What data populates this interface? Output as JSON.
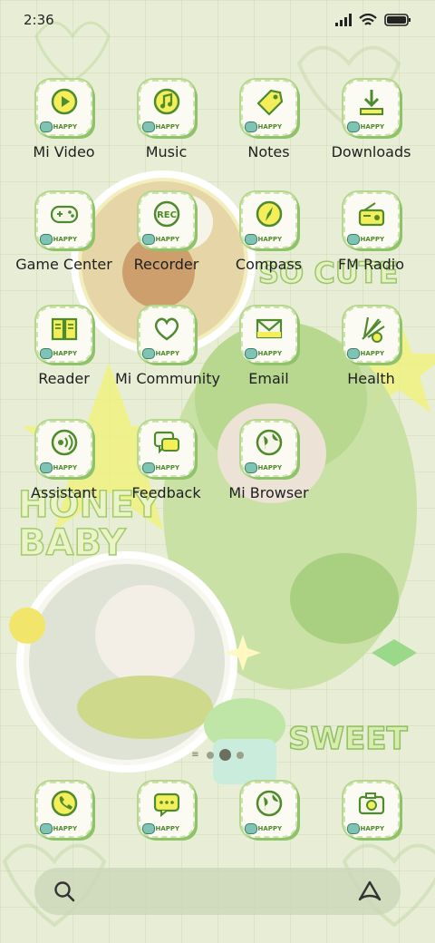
{
  "status_bar": {
    "time": "2:36"
  },
  "wallpaper": {
    "texts": {
      "so_cute": "SO CUTE",
      "honey": "HONEY",
      "baby": "BABY",
      "sweet": "SWEET"
    }
  },
  "apps": [
    {
      "label": "Mi Video",
      "icon": "play-icon"
    },
    {
      "label": "Music",
      "icon": "music-note-icon"
    },
    {
      "label": "Notes",
      "icon": "tag-icon"
    },
    {
      "label": "Downloads",
      "icon": "download-icon"
    },
    {
      "label": "Game Center",
      "icon": "gamepad-icon"
    },
    {
      "label": "Recorder",
      "icon": "rec-icon",
      "glyph_text": "REC"
    },
    {
      "label": "Compass",
      "icon": "compass-icon"
    },
    {
      "label": "FM Radio",
      "icon": "radio-icon"
    },
    {
      "label": "Reader",
      "icon": "book-icon"
    },
    {
      "label": "Mi Community",
      "icon": "heart-icon"
    },
    {
      "label": "Email",
      "icon": "envelope-icon"
    },
    {
      "label": "Health",
      "icon": "fan-icon"
    },
    {
      "label": "Assistant",
      "icon": "voice-icon"
    },
    {
      "label": "Feedback",
      "icon": "chat-icon"
    },
    {
      "label": "Mi Browser",
      "icon": "globe-icon"
    }
  ],
  "dock": [
    {
      "name": "phone",
      "icon": "phone-icon"
    },
    {
      "name": "messages",
      "icon": "message-icon"
    },
    {
      "name": "browser",
      "icon": "globe-icon"
    },
    {
      "name": "camera",
      "icon": "camera-icon"
    }
  ],
  "badge_text": "HAPPY",
  "colors": {
    "accent": "#8fc36a",
    "tile": "#fbfbf3",
    "glyph": "#4f8a2e",
    "yellow": "#f3ee5a"
  }
}
